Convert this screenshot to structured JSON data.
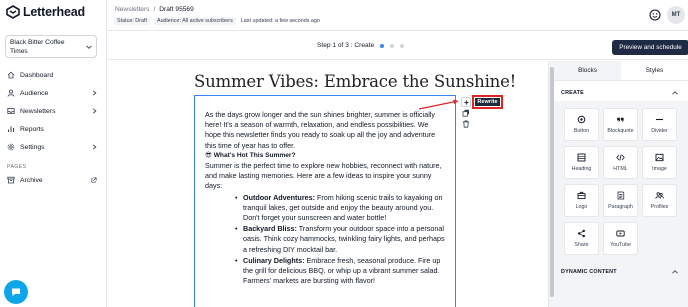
{
  "brand": {
    "name": "Letterhead",
    "accent": "#0ea5e9",
    "dark": "#1f2a44"
  },
  "sidebar": {
    "publication": "Black Bitter Coffee Times",
    "items": [
      {
        "label": "Dashboard",
        "icon": "home-icon"
      },
      {
        "label": "Audience",
        "icon": "user-icon"
      },
      {
        "label": "Newsletters",
        "icon": "inbox-icon"
      },
      {
        "label": "Reports",
        "icon": "chart-icon"
      },
      {
        "label": "Settings",
        "icon": "gear-icon"
      }
    ],
    "pages_label": "PAGES",
    "archive": "Archive"
  },
  "header": {
    "breadcrumb_parent": "Newsletters",
    "breadcrumb_sep": "/",
    "breadcrumb_current": "Draft 95569",
    "status_tag": "Status: Draft",
    "audience_tag": "Audience: All active subscribers",
    "updated": "Last updated: a few seconds ago",
    "avatar": "MT"
  },
  "toolbar": {
    "step": "Step 1 of 3 : Create",
    "preview_button": "Preview and schedule"
  },
  "editor": {
    "title": "Summer Vibes: Embrace the Sunshine!",
    "intro": "As the days grow longer and the sun shines brighter, summer is officially here! It's a season of warmth, relaxation, and endless possibilities. We hope this newsletter finds you ready to soak up all the joy and adventure this time of year has to offer.",
    "hot_heading": "😎 What's Hot This Summer?",
    "hot_body": "Summer is the perfect time to explore new hobbies, reconnect with nature, and make lasting memories. Here are a few ideas to inspire your sunny days:",
    "bullets": [
      {
        "title": "Outdoor Adventures:",
        "text": " From hiking scenic trails to kayaking on tranquil lakes, get outside and enjoy the beauty around you. Don't forget your sunscreen and water bottle!"
      },
      {
        "title": "Backyard Bliss:",
        "text": " Transform your outdoor space into a personal oasis. Think cozy hammocks, twinkling fairy lights, and perhaps a refreshing DIY mocktail bar."
      },
      {
        "title": "Culinary Delights:",
        "text": " Embrace fresh, seasonal produce. Fire up the grill for delicious BBQ, or whip up a vibrant summer salad. Farmers' markets are bursting with flavor!"
      }
    ],
    "rewrite_button": "Rewrite"
  },
  "panel": {
    "tabs": [
      "Blocks",
      "Styles"
    ],
    "create_heading": "CREATE",
    "dynamic_heading": "DYNAMIC CONTENT",
    "blocks": [
      {
        "label": "Button",
        "icon": "button-icon"
      },
      {
        "label": "Blockquote",
        "icon": "quote-icon"
      },
      {
        "label": "Divider",
        "icon": "divider-icon"
      },
      {
        "label": "Heading",
        "icon": "heading-icon"
      },
      {
        "label": "HTML",
        "icon": "code-icon"
      },
      {
        "label": "Image",
        "icon": "image-icon"
      },
      {
        "label": "Logo",
        "icon": "logo-icon"
      },
      {
        "label": "Paragraph",
        "icon": "paragraph-icon"
      },
      {
        "label": "Profiles",
        "icon": "profiles-icon"
      },
      {
        "label": "Share",
        "icon": "share-icon"
      },
      {
        "label": "YouTube",
        "icon": "youtube-icon"
      }
    ]
  }
}
